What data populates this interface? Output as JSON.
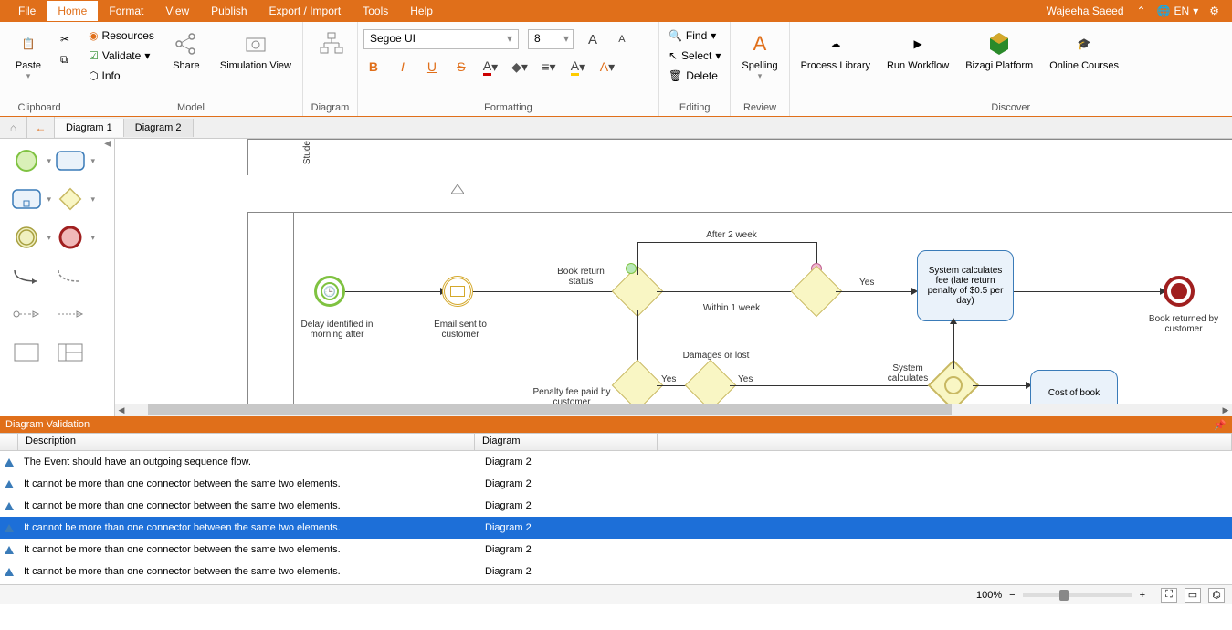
{
  "menubar": {
    "items": [
      "File",
      "Home",
      "Format",
      "View",
      "Publish",
      "Export / Import",
      "Tools",
      "Help"
    ],
    "active": "Home",
    "user": "Wajeeha Saeed",
    "lang": "EN"
  },
  "ribbon": {
    "clipboard": {
      "paste": "Paste",
      "label": "Clipboard"
    },
    "model": {
      "resources": "Resources",
      "validate": "Validate",
      "info": "Info",
      "share": "Share",
      "sim": "Simulation View",
      "label": "Model"
    },
    "diagram": {
      "label": "Diagram"
    },
    "formatting": {
      "font": "Segoe UI",
      "size": "8",
      "label": "Formatting"
    },
    "editing": {
      "find": "Find",
      "select": "Select",
      "delete": "Delete",
      "label": "Editing"
    },
    "review": {
      "spelling": "Spelling",
      "label": "Review"
    },
    "discover": {
      "plib": "Process Library",
      "run": "Run Workflow",
      "platform": "Bizagi Platform",
      "courses": "Online Courses",
      "label": "Discover"
    }
  },
  "tabs": {
    "items": [
      "Diagram 1",
      "Diagram 2"
    ],
    "active": "Diagram 2"
  },
  "diagram": {
    "lane": "Stude",
    "start": "Delay identified in morning after",
    "email": "Email sent to customer",
    "bookstatus": "Book return status",
    "after2": "After 2 week",
    "within1": "Within 1 week",
    "yes1": "Yes",
    "yes2": "Yes",
    "yes3": "Yes",
    "damlost": "Damages or lost",
    "penalty": "Penalty fee paid by customer",
    "syscalc": "System calculates",
    "task_fee": "System calculates fee (late return penalty of $0.5 per day)",
    "task_cost": "Cost of book",
    "returned": "Book returned by customer"
  },
  "validation": {
    "title": "Diagram Validation",
    "col_desc": "Description",
    "col_diag": "Diagram",
    "rows": [
      {
        "desc": "The Event should have an outgoing sequence flow.",
        "diag": "Diagram 2"
      },
      {
        "desc": "It cannot be more than one connector between the same two elements.",
        "diag": "Diagram 2"
      },
      {
        "desc": "It cannot be more than one connector between the same two elements.",
        "diag": "Diagram 2"
      },
      {
        "desc": "It cannot be more than one connector between the same two elements.",
        "diag": "Diagram 2"
      },
      {
        "desc": "It cannot be more than one connector between the same two elements.",
        "diag": "Diagram 2"
      },
      {
        "desc": "It cannot be more than one connector between the same two elements.",
        "diag": "Diagram 2"
      }
    ],
    "selected": 3
  },
  "status": {
    "zoom": "100%"
  }
}
